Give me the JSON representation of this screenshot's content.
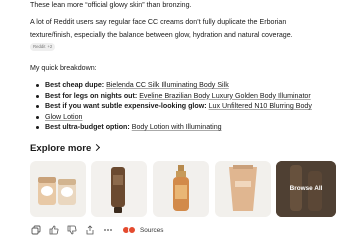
{
  "text": {
    "line1": "These lean more “official glowy skin” than bronzing.",
    "line2": "A lot of Reddit users say regular face CC creams don’t fully duplicate the Erborian",
    "line3": "texture/finish, especially the balance between glow, hydration and natural coverage.",
    "citation_chip": "Reddit",
    "citation_plus": "+2",
    "line4": "My quick breakdown:"
  },
  "bullets": [
    {
      "label": "Best cheap dupe:",
      "value": "Bielenda CC Silk Illuminating Body Silk"
    },
    {
      "label": "Best for legs on nights out:",
      "value": "Eveline Brazilian Body Luxury Golden Body Illuminator"
    },
    {
      "label": "Best if you want subtle expensive-looking glow:",
      "value": "Lux Unfiltered N10 Blurring Body"
    },
    {
      "label": "",
      "value": "Glow Lotion"
    },
    {
      "label": "Best ultra-budget option:",
      "value": "Body Lotion with Illuminating"
    }
  ],
  "explore": {
    "title": "Explore more",
    "browse_all": "Browse All"
  },
  "actions": {
    "sources_label": "Sources"
  },
  "colors": {
    "text": "#1a1a1a",
    "chip_bg": "#efefef",
    "source_dot": "#e44b2f"
  }
}
